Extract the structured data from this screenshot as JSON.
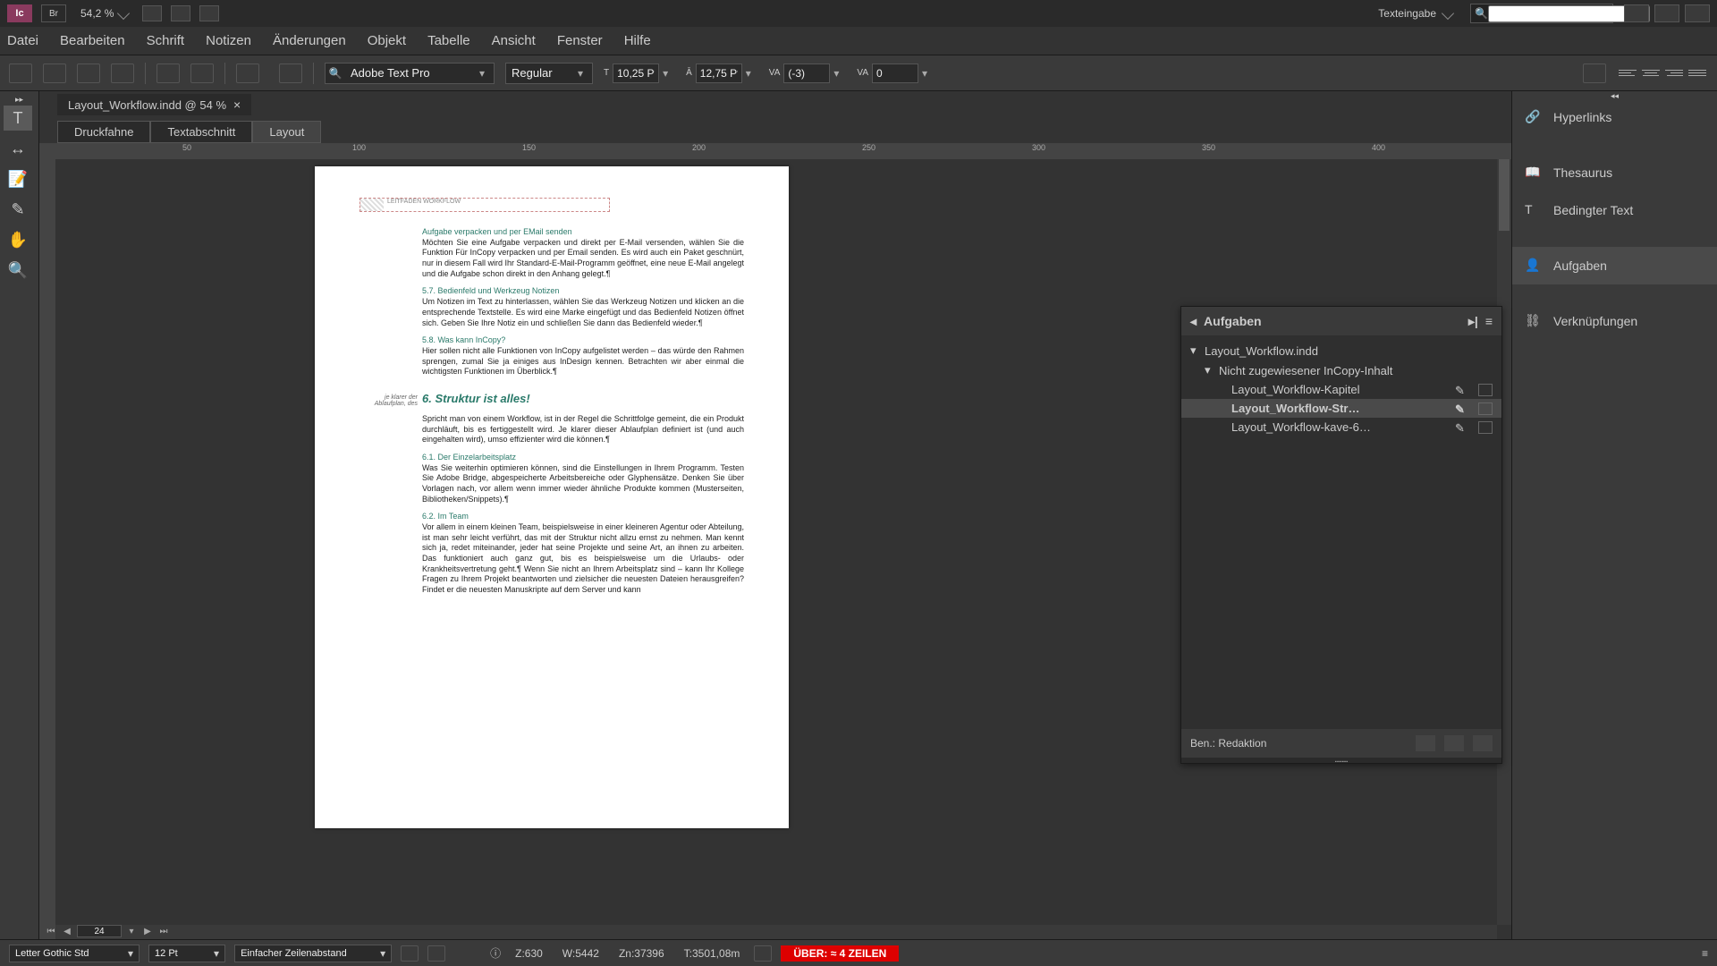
{
  "app": {
    "icon_text": "Ic",
    "bridge": "Br",
    "zoom": "54,2 %"
  },
  "workspace": {
    "label": "Texteingabe"
  },
  "search": {
    "placeholder": ""
  },
  "menu": [
    "Datei",
    "Bearbeiten",
    "Schrift",
    "Notizen",
    "Änderungen",
    "Objekt",
    "Tabelle",
    "Ansicht",
    "Fenster",
    "Hilfe"
  ],
  "control": {
    "font_family": "Adobe Text Pro",
    "font_style": "Regular",
    "font_size": "10,25 Pt",
    "leading": "12,75 Pt",
    "tracking": "(-3)",
    "kerning": "0"
  },
  "doc_tab": {
    "label": "Layout_Workflow.indd @ 54 %"
  },
  "view_tabs": [
    {
      "label": "Druckfahne",
      "active": false
    },
    {
      "label": "Textabschnitt",
      "active": false
    },
    {
      "label": "Layout",
      "active": true
    }
  ],
  "ruler_marks": [
    "50",
    "100",
    "150",
    "200",
    "250",
    "300",
    "350",
    "400"
  ],
  "page": {
    "header_text": "LEITFADEN WORKFLOW",
    "margin_note": "je klarer der Ablaufplan, des",
    "h1": "5.7.  Bedienfeld und Werkzeug Notizen",
    "h1_title": "Aufgabe verpacken und per EMail senden",
    "p1": "Möchten Sie eine Aufgabe verpacken und direkt per E-Mail versenden, wählen Sie die Funktion Für InCopy verpacken und per Email senden. Es wird auch ein Paket geschnürt, nur in diesem Fall wird Ihr Standard-E-Mail-Programm geöffnet, eine neue E-Mail angelegt und die Aufgabe schon direkt in den Anhang gelegt.¶",
    "p2": "Um Notizen im Text zu hinterlassen, wählen Sie das Werkzeug Notizen und klicken an die entsprechende Textstelle. Es wird eine Marke eingefügt und das Bedienfeld Notizen öffnet sich. Geben Sie Ihre Notiz ein und schließen Sie dann das Bedienfeld wieder.¶",
    "h2": "5.8.  Was kann InCopy?",
    "p3": "Hier sollen nicht alle Funktionen von InCopy aufgelistet werden – das würde den Rahmen sprengen, zumal Sie ja einiges aus InDesign kennen. Betrachten wir aber einmal die wichtigsten Funktionen im Überblick.¶",
    "h3": "6.  Struktur ist alles!",
    "p4": "Spricht man von einem Workflow, ist in der Regel die Schrittfolge gemeint, die ein Produkt durchläuft, bis es fertiggestellt wird. Je klarer dieser Ablaufplan definiert ist (und auch eingehalten wird), umso effizienter wird die können.¶",
    "h4": "6.1.  Der Einzelarbeitsplatz",
    "p5": "Was Sie weiterhin optimieren können, sind die Einstellungen in Ihrem Programm. Testen Sie Adobe Bridge, abgespeicherte Arbeitsbereiche oder Glyphensätze. Denken Sie über Vorlagen nach, vor allem wenn immer wieder ähnliche Produkte kommen (Musterseiten, Bibliotheken/Snippets).¶",
    "h5": "6.2.  Im Team",
    "p6": "Vor allem in einem kleinen Team, beispielsweise in einer kleineren Agentur oder Abteilung, ist man sehr leicht verführt, das mit der Struktur nicht allzu ernst zu nehmen. Man kennt sich ja, redet miteinander, jeder hat seine Projekte und seine Art, an ihnen zu arbeiten. Das funktioniert auch ganz gut, bis es beispielsweise um die Urlaubs- oder Krankheitsvertretung geht.¶\n  Wenn Sie nicht an Ihrem Arbeitsplatz sind – kann Ihr Kollege Fragen zu Ihrem Projekt beantworten und zielsicher die neuesten Dateien herausgreifen? Findet er die neuesten Manuskripte auf dem Server und kann"
  },
  "pager": {
    "current": "24"
  },
  "right_panels": [
    {
      "label": "Hyperlinks",
      "icon": "🔗"
    },
    {
      "label": "Thesaurus",
      "icon": "📖"
    },
    {
      "label": "Bedingter Text",
      "icon": "T"
    },
    {
      "label": "Aufgaben",
      "icon": "👤",
      "active": true
    },
    {
      "label": "Verknüpfungen",
      "icon": "⛓"
    }
  ],
  "aufgaben": {
    "title": "Aufgaben",
    "root": "Layout_Workflow.indd",
    "group": "Nicht zugewiesener InCopy-Inhalt",
    "items": [
      {
        "label": "Layout_Workflow-Kapitel",
        "sel": false,
        "icon": "✎",
        "end": "📄"
      },
      {
        "label": "Layout_Workflow-Str…",
        "sel": true,
        "icon": "✎",
        "end": "📄"
      },
      {
        "label": "Layout_Workflow-kave-6…",
        "sel": false,
        "icon": "✎",
        "end": "✖"
      }
    ],
    "footer_label": "Ben.: Redaktion"
  },
  "status": {
    "font": "Letter Gothic Std",
    "size": "12 Pt",
    "spacing": "Einfacher Zeilenabstand",
    "z": "Z:630",
    "w": "W:5442",
    "zn": "Zn:37396",
    "t": "T:3501,08m",
    "overset": "ÜBER:  ≈ 4 ZEILEN"
  }
}
